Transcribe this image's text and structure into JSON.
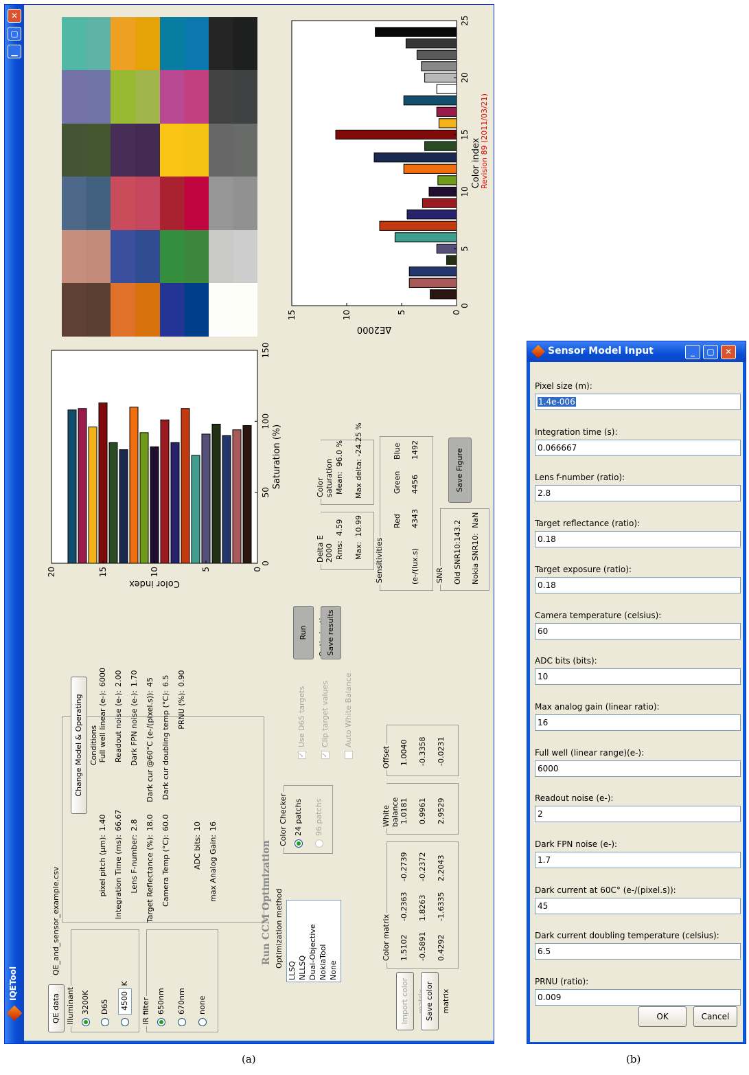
{
  "window_a": {
    "title": "IQETool",
    "qe_button": "QE data",
    "qe_file": "QE_and_sensor_example.csv",
    "illuminant": {
      "title": "Illuminant",
      "options": [
        "3200K",
        "D65"
      ],
      "custom_value": "4500",
      "unit": "K"
    },
    "ir_filter": {
      "title": "IR filter",
      "options": [
        "650nm",
        "670nm",
        "none"
      ]
    },
    "change_button": "Change Model & Operating Conditions",
    "sensor_params_left": [
      {
        "label": "pixel pitch (µm):",
        "value": "1.40"
      },
      {
        "label": "Integration Time (ms):",
        "value": "66.67"
      },
      {
        "label": "Lens F-number:",
        "value": "2.8"
      },
      {
        "label": "Target Reflectance (%):",
        "value": "18.0"
      },
      {
        "label": "Camera Temp (°C):",
        "value": "60.0"
      },
      {
        "label": "",
        "value": ""
      },
      {
        "label": "ADC bits:",
        "value": "10"
      },
      {
        "label": "max Analog Gain:",
        "value": "16"
      }
    ],
    "sensor_params_right": [
      {
        "label": "Full well linear (e-):",
        "value": "6000"
      },
      {
        "label": "Readout noise (e-):",
        "value": "2.00"
      },
      {
        "label": "Dark FPN noise (e-):",
        "value": "1.70"
      },
      {
        "label": "Dark cur @60°C (e-/(pixel.s)):",
        "value": "45"
      },
      {
        "label": "Dark cur doubling temp (°C):",
        "value": "6.5"
      },
      {
        "label": "PRNU (%):",
        "value": "0.90"
      }
    ],
    "ccm_title": "Run CCM Optimization",
    "opt_method_label": "Optimization method",
    "opt_methods": [
      "LLSQ",
      "NLLSQ",
      "Dual-Objective",
      "NokiaTool",
      "None"
    ],
    "color_checker": {
      "title": "Color Checker",
      "options": [
        "24 patchs",
        "96 patchs"
      ]
    },
    "checkboxes": [
      "Use D65 targets",
      "Clip target values",
      "Auto White Balance"
    ],
    "run_button": "Run Optimization",
    "save_results_button": "Save results",
    "import_button": "Import color matrix",
    "save_matrix_button": "Save color matrix",
    "color_matrix": {
      "title": "Color matrix",
      "rows": [
        [
          "1.5102",
          "-0.2363",
          "-0.2739"
        ],
        [
          "-0.5891",
          "1.8263",
          "-0.2372"
        ],
        [
          "0.4292",
          "-1.6335",
          "2.2043"
        ]
      ]
    },
    "white_balance": {
      "title": "White balance",
      "values": [
        "1.0181",
        "0.9961",
        "2.9529"
      ]
    },
    "offset": {
      "title": "Offset",
      "values": [
        "1.0040",
        "-0.3358",
        "-0.0231"
      ]
    },
    "delta_e": {
      "title": "Delta E 2000",
      "rms_label": "Rms:",
      "rms": "4.59",
      "max_label": "Max:",
      "max": "10.99"
    },
    "color_saturation": {
      "title": "Color saturation",
      "mean_label": "Mean:",
      "mean": "96.0 %",
      "maxdelta_label": "Max delta:",
      "maxdelta": "-24.25 %"
    },
    "sensitivities": {
      "title": "Sensitivities",
      "unit": "(e-/(lux.s)",
      "headers": [
        "Red",
        "Green",
        "Blue"
      ],
      "values": [
        "4343",
        "4456",
        "1492"
      ]
    },
    "snr": {
      "title": "SNR",
      "old_label": "Old SNR10:",
      "old": "143.2",
      "nokia_label": "Nokia SNR10:",
      "nokia": "NaN"
    },
    "save_figure_button": "Save Figure",
    "revision": "Revision 89 (2011/03/21)",
    "patch_colors": [
      [
        "#603f34",
        "#c78d7d",
        "#4d6889",
        "#445434",
        "#7572a8",
        "#50b8a4"
      ],
      [
        "#e07128",
        "#3a4f9e",
        "#c84c5a",
        "#472e57",
        "#98ba33",
        "#eea023"
      ],
      [
        "#233396",
        "#338e3e",
        "#aa2230",
        "#fac415",
        "#b84891",
        "#077da2"
      ],
      [
        "#fdfdfb",
        "#c9c9c8",
        "#969696",
        "#676767",
        "#434343",
        "#252525"
      ]
    ],
    "patch_alt_colors": [
      [
        "#5a3e32",
        "#c38a7a",
        "#42607f",
        "#44582f",
        "#7074a6",
        "#5fb2a6"
      ],
      [
        "#d7720d",
        "#2f4c91",
        "#c5475f",
        "#442a52",
        "#a0b54b",
        "#e6a307"
      ],
      [
        "#013e8a",
        "#3d873d",
        "#c00540",
        "#f4c313",
        "#c2407e",
        "#0a78ad"
      ],
      [
        "#fefef8",
        "#cdcdcd",
        "#919191",
        "#686b67",
        "#3f4242",
        "#1e2020"
      ]
    ]
  },
  "chart_data": [
    {
      "type": "bar",
      "orientation": "horizontal",
      "xlabel": "Saturation (%)",
      "ylabel": "Color index",
      "xlim": [
        0,
        150
      ],
      "ylim": [
        0,
        20
      ],
      "xticks": [
        "0",
        "50",
        "100",
        "150"
      ],
      "yticks": [
        "0",
        "5",
        "10",
        "15",
        "20"
      ],
      "categories": [
        1,
        2,
        3,
        4,
        5,
        6,
        7,
        8,
        9,
        10,
        11,
        12,
        13,
        14,
        15,
        16,
        17,
        18
      ],
      "values": [
        97,
        94,
        90,
        98,
        91,
        76,
        109,
        85,
        101,
        82,
        92,
        110,
        80,
        85,
        113,
        96,
        109,
        108
      ],
      "colors": [
        "#2a1510",
        "#a85a5a",
        "#23366b",
        "#233015",
        "#54507a",
        "#3f9e8e",
        "#c33a0f",
        "#26226b",
        "#9b1b20",
        "#220e30",
        "#6f9a1a",
        "#f06d10",
        "#1a2950",
        "#2a4a25",
        "#7f0a0a",
        "#f2b31a",
        "#9a1a4a",
        "#124e6c"
      ]
    },
    {
      "type": "bar",
      "xlabel": "Color index",
      "ylabel": "ΔE2000",
      "xlim": [
        0,
        25
      ],
      "ylim": [
        0,
        15
      ],
      "xticks": [
        "0",
        "5",
        "10",
        "15",
        "20",
        "25"
      ],
      "yticks": [
        "0",
        "5",
        "10",
        "15"
      ],
      "categories": [
        1,
        2,
        3,
        4,
        5,
        6,
        7,
        8,
        9,
        10,
        11,
        12,
        13,
        14,
        15,
        16,
        17,
        18,
        19,
        20,
        21,
        22,
        23,
        24
      ],
      "values": [
        2.4,
        4.3,
        4.3,
        0.9,
        1.8,
        5.6,
        7.0,
        4.5,
        3.1,
        2.5,
        1.7,
        4.8,
        7.5,
        2.9,
        11.0,
        1.6,
        1.8,
        4.8,
        1.8,
        2.9,
        3.2,
        3.6,
        4.6,
        7.4
      ],
      "colors": [
        "#2a1510",
        "#a85a5a",
        "#23366b",
        "#233015",
        "#54507a",
        "#3f9e8e",
        "#c33a0f",
        "#26226b",
        "#9b1b20",
        "#220e30",
        "#6f9a1a",
        "#f06d10",
        "#1a2950",
        "#2a4a25",
        "#7f0a0a",
        "#f2b31a",
        "#9a1a4a",
        "#124e6c",
        "#ffffff",
        "#b8b8b8",
        "#888888",
        "#5a5a5a",
        "#353535",
        "#080808"
      ]
    }
  ],
  "window_b": {
    "title": "Sensor Model Input",
    "fields": [
      {
        "label": "Pixel size (m):",
        "value": "1.4e-006"
      },
      {
        "label": "Integration time (s):",
        "value": "0.066667"
      },
      {
        "label": "Lens f-number (ratio):",
        "value": "2.8"
      },
      {
        "label": "Target reflectance (ratio):",
        "value": "0.18"
      },
      {
        "label": "Target exposure (ratio):",
        "value": "0.18"
      },
      {
        "label": "Camera temperature (celsius):",
        "value": "60"
      },
      {
        "label": "ADC bits (bits):",
        "value": "10"
      },
      {
        "label": "Max analog gain (linear ratio):",
        "value": "16"
      },
      {
        "label": "Full well (linear range)(e-):",
        "value": "6000"
      },
      {
        "label": "Readout noise (e-):",
        "value": "2"
      },
      {
        "label": "Dark FPN noise (e-):",
        "value": "1.7"
      },
      {
        "label": "Dark current at 60C° (e-/(pixel.s)):",
        "value": "45"
      },
      {
        "label": "Dark current doubling temperature (celsius):",
        "value": "6.5"
      },
      {
        "label": "PRNU (ratio):",
        "value": "0.009"
      }
    ],
    "ok": "OK",
    "cancel": "Cancel"
  },
  "captions": [
    "(a)",
    "(b)"
  ]
}
